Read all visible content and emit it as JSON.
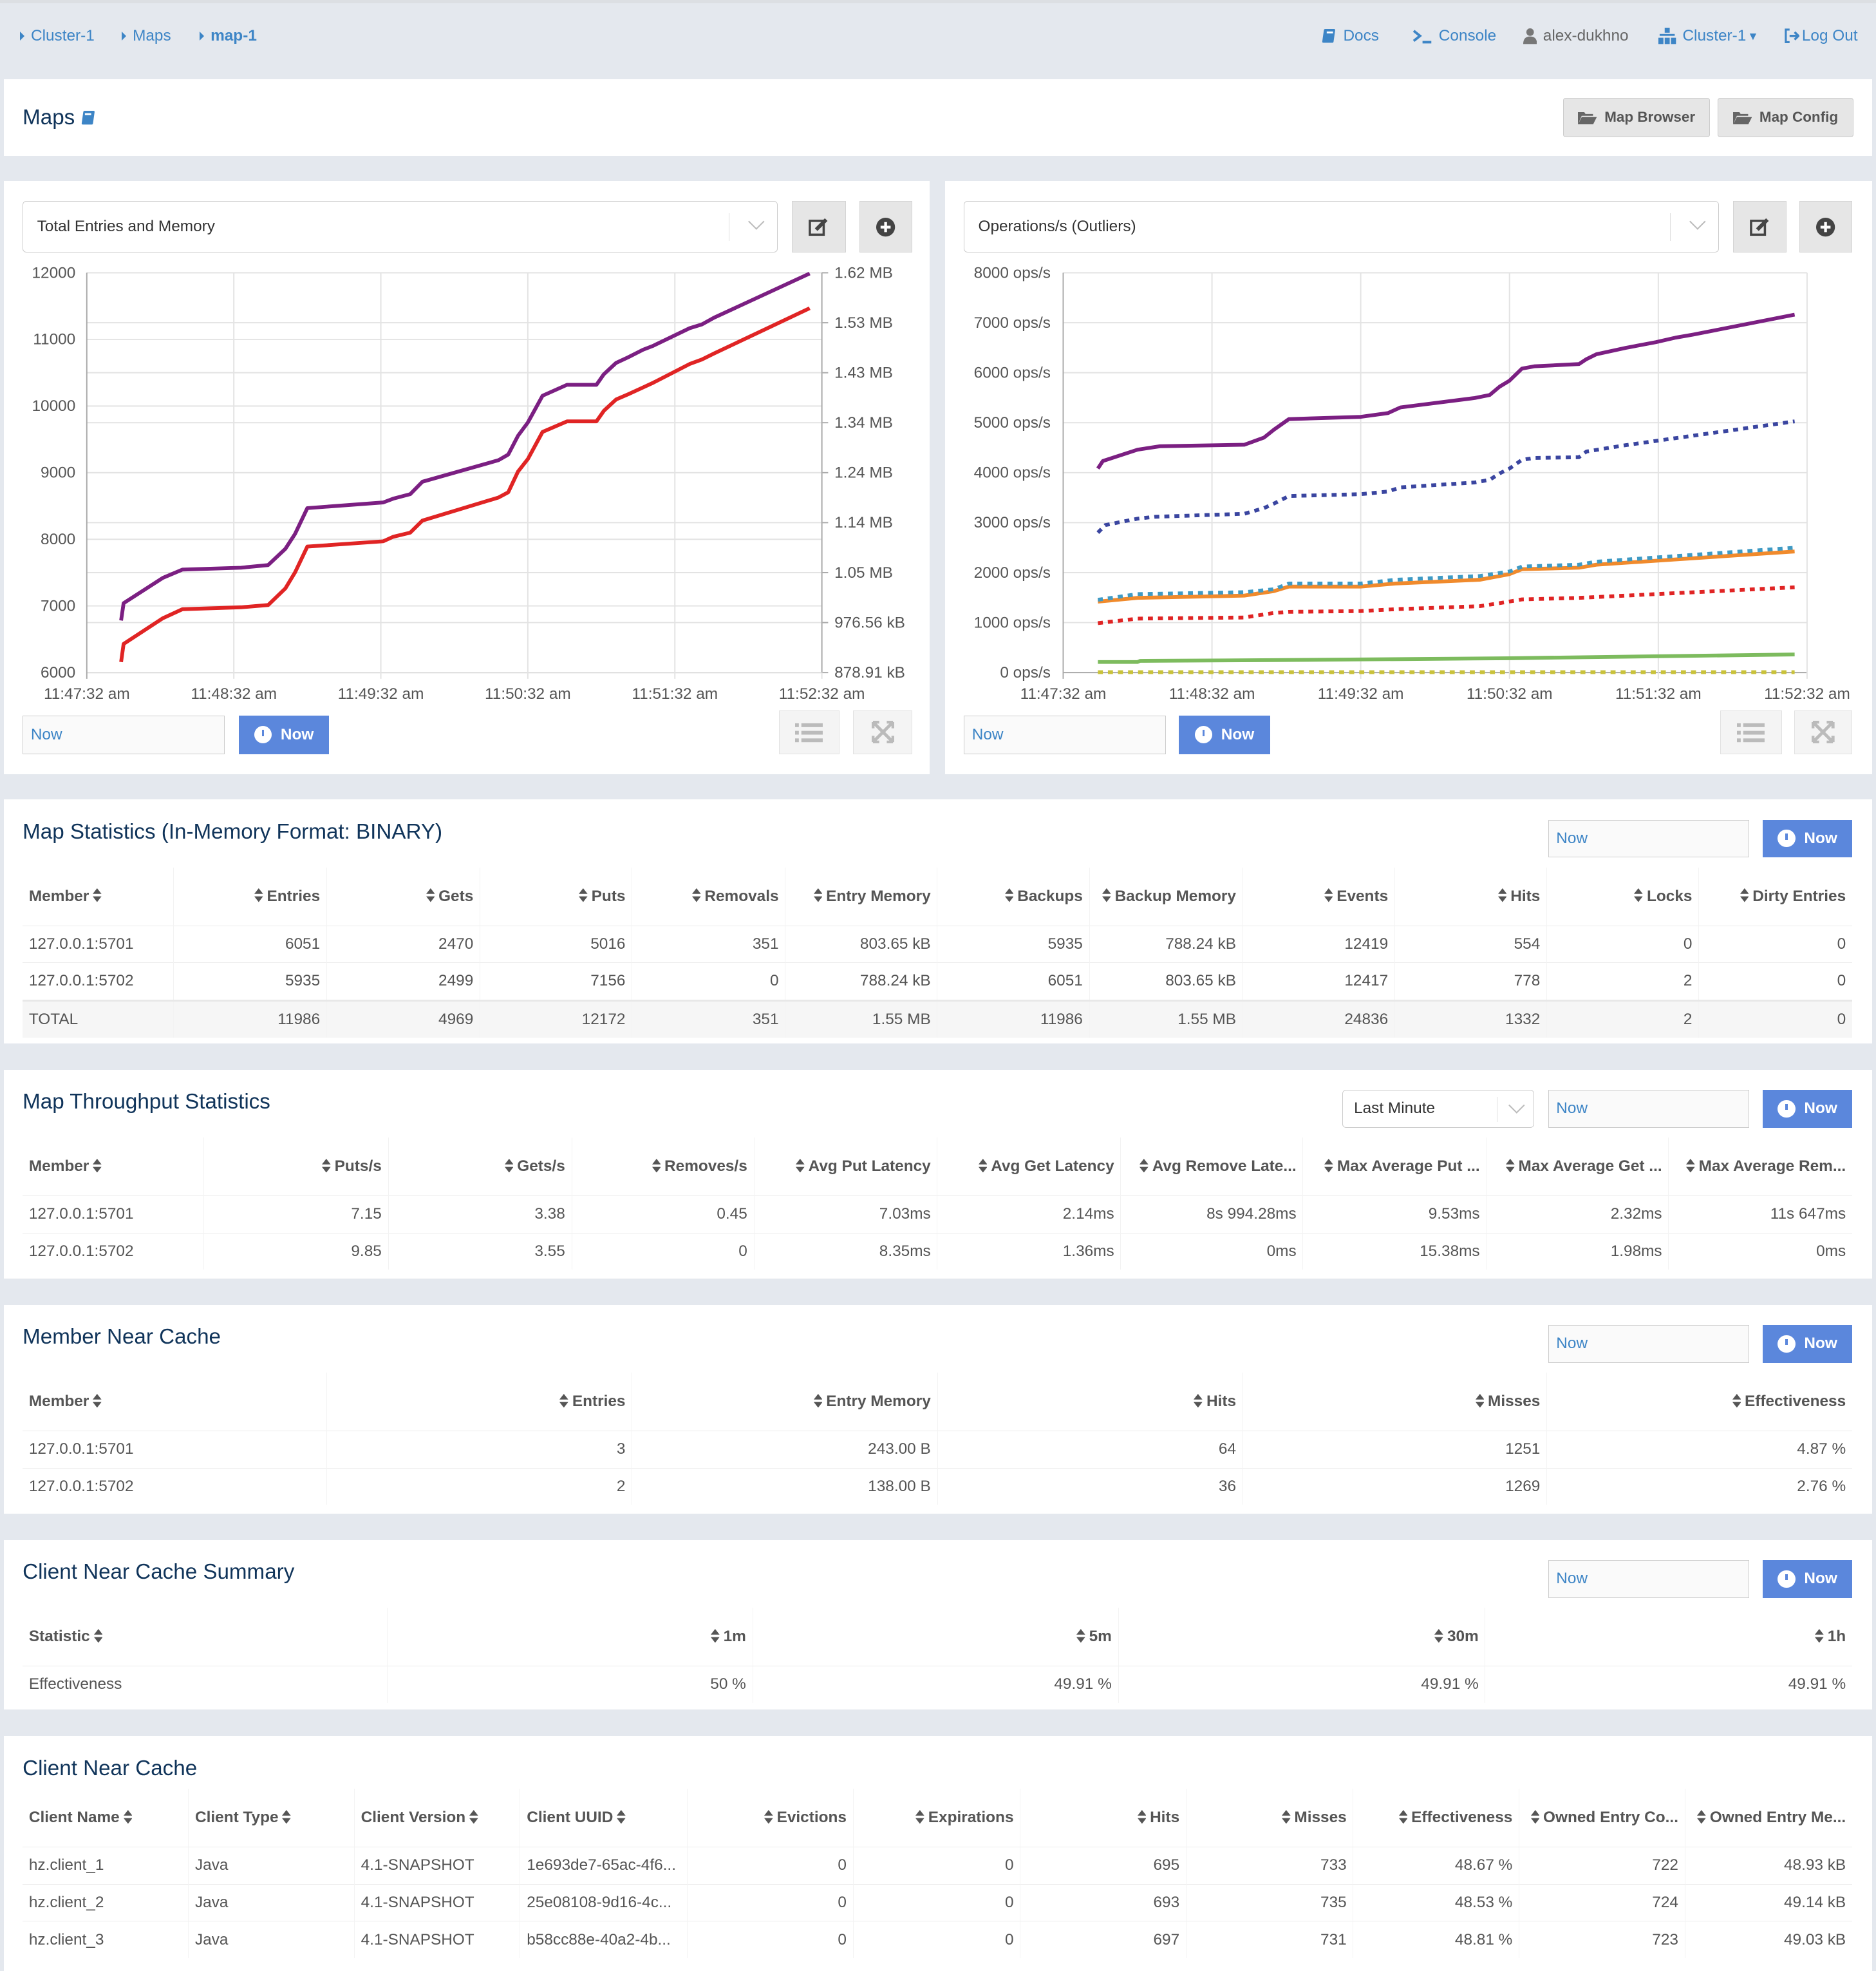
{
  "topbar": {
    "breadcrumb": [
      "Cluster-1",
      "Maps",
      "map-1"
    ],
    "docs": "Docs",
    "console": "Console",
    "user": "alex-dukhno",
    "cluster": "Cluster-1",
    "logout": "Log Out"
  },
  "header": {
    "title": "Maps",
    "map_browser": "Map Browser",
    "map_config": "Map Config"
  },
  "colors": {
    "link": "#3d85c6",
    "now_button": "#5b87dc",
    "title": "#10345a"
  },
  "charts": [
    {
      "selector_value": "Total Entries and Memory",
      "now_input": "Now",
      "now_button": "Now"
    },
    {
      "selector_value": "Operations/s (Outliers)",
      "now_input": "Now",
      "now_button": "Now"
    }
  ],
  "chart_data": [
    {
      "type": "line",
      "xlim": [
        "11:47:32",
        "11:52:32"
      ],
      "x_ticks": [
        "11:47:32 am",
        "11:48:32 am",
        "11:49:32 am",
        "11:50:32 am",
        "11:51:32 am",
        "11:52:32 am"
      ],
      "ylim": [
        6000,
        12000
      ],
      "y_ticks": [
        "12000",
        "11000",
        "10000",
        "9000",
        "8000",
        "7000",
        "6000"
      ],
      "y2_ticks": [
        "1.62 MB",
        "1.53 MB",
        "1.43 MB",
        "1.34 MB",
        "1.24 MB",
        "1.14 MB",
        "1.05 MB",
        "976.56 kB",
        "878.91 kB"
      ],
      "grid": true,
      "series": [
        {
          "color": "#7b1f82",
          "style": "solid",
          "points": [
            [
              "11:47:46",
              6781
            ],
            [
              "11:47:47",
              7041
            ],
            [
              "11:48:03",
              7421
            ],
            [
              "11:48:11",
              7545
            ],
            [
              "11:48:35",
              7573
            ],
            [
              "11:48:46",
              7613
            ],
            [
              "11:48:53",
              7857
            ],
            [
              "11:48:57",
              8083
            ],
            [
              "11:49:02",
              8468
            ],
            [
              "11:49:33",
              8553
            ],
            [
              "11:49:37",
              8609
            ],
            [
              "11:49:44",
              8677
            ],
            [
              "11:49:49",
              8864
            ],
            [
              "11:50:20",
              9187
            ],
            [
              "11:50:24",
              9271
            ],
            [
              "11:50:28",
              9555
            ],
            [
              "11:50:32",
              9753
            ],
            [
              "11:50:38",
              10154
            ],
            [
              "11:50:48",
              10319
            ],
            [
              "11:51:00",
              10319
            ],
            [
              "11:51:03",
              10477
            ],
            [
              "11:51:08",
              10647
            ],
            [
              "11:51:13",
              10732
            ],
            [
              "11:51:19",
              10845
            ],
            [
              "11:51:23",
              10902
            ],
            [
              "11:51:38",
              11168
            ],
            [
              "11:51:43",
              11224
            ],
            [
              "11:51:48",
              11326
            ],
            [
              "11:52:27",
              11988
            ]
          ]
        },
        {
          "color": "#e02424",
          "style": "solid",
          "points": [
            [
              "11:47:46",
              6158
            ],
            [
              "11:47:47",
              6430
            ],
            [
              "11:48:03",
              6815
            ],
            [
              "11:48:11",
              6951
            ],
            [
              "11:48:35",
              6979
            ],
            [
              "11:48:46",
              7013
            ],
            [
              "11:48:53",
              7262
            ],
            [
              "11:48:57",
              7506
            ],
            [
              "11:49:02",
              7890
            ],
            [
              "11:49:33",
              7970
            ],
            [
              "11:49:37",
              8038
            ],
            [
              "11:49:44",
              8100
            ],
            [
              "11:49:49",
              8281
            ],
            [
              "11:50:20",
              8626
            ],
            [
              "11:50:24",
              8706
            ],
            [
              "11:50:28",
              9017
            ],
            [
              "11:50:32",
              9204
            ],
            [
              "11:50:38",
              9611
            ],
            [
              "11:50:48",
              9770
            ],
            [
              "11:51:00",
              9770
            ],
            [
              "11:51:03",
              9928
            ],
            [
              "11:51:08",
              10098
            ],
            [
              "11:51:13",
              10177
            ],
            [
              "11:51:19",
              10279
            ],
            [
              "11:51:23",
              10347
            ],
            [
              "11:51:38",
              10630
            ],
            [
              "11:51:43",
              10698
            ],
            [
              "11:51:48",
              10789
            ],
            [
              "11:52:27",
              11468
            ]
          ]
        }
      ]
    },
    {
      "type": "line",
      "xlim": [
        "11:47:32",
        "11:52:32"
      ],
      "x_ticks": [
        "11:47:32 am",
        "11:48:32 am",
        "11:49:32 am",
        "11:50:32 am",
        "11:51:32 am",
        "11:52:32 am"
      ],
      "ylim": [
        0,
        8000
      ],
      "y_ticks": [
        "8000 ops/s",
        "7000 ops/s",
        "6000 ops/s",
        "5000 ops/s",
        "4000 ops/s",
        "3000 ops/s",
        "2000 ops/s",
        "1000 ops/s",
        "0 ops/s"
      ],
      "grid": true,
      "series": [
        {
          "color": "#7b1f82",
          "style": "solid",
          "points": [
            [
              "11:47:46",
              4083
            ],
            [
              "11:47:48",
              4234
            ],
            [
              "11:48:02",
              4460
            ],
            [
              "11:48:11",
              4528
            ],
            [
              "11:48:45",
              4558
            ],
            [
              "11:48:53",
              4702
            ],
            [
              "11:48:57",
              4860
            ],
            [
              "11:49:03",
              5072
            ],
            [
              "11:49:32",
              5117
            ],
            [
              "11:49:43",
              5192
            ],
            [
              "11:49:48",
              5306
            ],
            [
              "11:50:18",
              5494
            ],
            [
              "11:50:24",
              5555
            ],
            [
              "11:50:28",
              5721
            ],
            [
              "11:50:32",
              5841
            ],
            [
              "11:50:37",
              6083
            ],
            [
              "11:50:42",
              6128
            ],
            [
              "11:51:00",
              6174
            ],
            [
              "11:51:03",
              6272
            ],
            [
              "11:51:07",
              6370
            ],
            [
              "11:51:19",
              6498
            ],
            [
              "11:51:31",
              6611
            ],
            [
              "11:51:39",
              6702
            ],
            [
              "11:51:46",
              6762
            ],
            [
              "11:52:27",
              7162
            ]
          ]
        },
        {
          "color": "#3a45a0",
          "style": "dotted",
          "points": [
            [
              "11:47:46",
              2800
            ],
            [
              "11:47:49",
              2951
            ],
            [
              "11:48:02",
              3079
            ],
            [
              "11:48:09",
              3117
            ],
            [
              "11:48:45",
              3177
            ],
            [
              "11:48:53",
              3290
            ],
            [
              "11:48:57",
              3381
            ],
            [
              "11:49:03",
              3532
            ],
            [
              "11:49:32",
              3570
            ],
            [
              "11:49:43",
              3623
            ],
            [
              "11:49:48",
              3706
            ],
            [
              "11:50:18",
              3804
            ],
            [
              "11:50:24",
              3857
            ],
            [
              "11:50:28",
              3985
            ],
            [
              "11:50:32",
              4083
            ],
            [
              "11:50:37",
              4257
            ],
            [
              "11:50:42",
              4294
            ],
            [
              "11:51:00",
              4309
            ],
            [
              "11:51:03",
              4423
            ],
            [
              "11:51:19",
              4551
            ],
            [
              "11:52:27",
              5026
            ]
          ]
        },
        {
          "color": "#f08a2c",
          "style": "solid",
          "points": [
            [
              "11:47:46",
              1419
            ],
            [
              "11:48:02",
              1494
            ],
            [
              "11:48:45",
              1540
            ],
            [
              "11:48:57",
              1630
            ],
            [
              "11:49:03",
              1721
            ],
            [
              "11:49:32",
              1721
            ],
            [
              "11:49:46",
              1781
            ],
            [
              "11:50:20",
              1857
            ],
            [
              "11:50:32",
              1970
            ],
            [
              "11:50:37",
              2068
            ],
            [
              "11:51:00",
              2098
            ],
            [
              "11:51:07",
              2158
            ],
            [
              "11:52:27",
              2423
            ]
          ]
        },
        {
          "color": "#3f9ac4",
          "style": "dotted",
          "points": [
            [
              "11:47:46",
              1457
            ],
            [
              "11:48:02",
              1570
            ],
            [
              "11:48:45",
              1608
            ],
            [
              "11:48:57",
              1668
            ],
            [
              "11:49:03",
              1781
            ],
            [
              "11:49:32",
              1781
            ],
            [
              "11:49:46",
              1857
            ],
            [
              "11:50:20",
              1932
            ],
            [
              "11:50:32",
              2023
            ],
            [
              "11:50:37",
              2121
            ],
            [
              "11:51:00",
              2158
            ],
            [
              "11:51:07",
              2219
            ],
            [
              "11:52:27",
              2498
            ]
          ]
        },
        {
          "color": "#e02424",
          "style": "dotted",
          "points": [
            [
              "11:47:46",
              989
            ],
            [
              "11:48:02",
              1079
            ],
            [
              "11:48:45",
              1102
            ],
            [
              "11:48:57",
              1192
            ],
            [
              "11:49:03",
              1215
            ],
            [
              "11:49:32",
              1230
            ],
            [
              "11:49:46",
              1268
            ],
            [
              "11:50:20",
              1328
            ],
            [
              "11:50:28",
              1389
            ],
            [
              "11:50:37",
              1464
            ],
            [
              "11:51:00",
              1494
            ],
            [
              "11:52:27",
              1706
            ]
          ]
        },
        {
          "color": "#7dbb5e",
          "style": "solid",
          "points": [
            [
              "11:47:46",
              211
            ],
            [
              "11:48:02",
              211
            ],
            [
              "11:48:03",
              234
            ],
            [
              "11:48:57",
              249
            ],
            [
              "11:50:32",
              287
            ],
            [
              "11:52:27",
              362
            ]
          ]
        },
        {
          "color": "#c9c23a",
          "style": "dotted",
          "points": [
            [
              "11:47:46",
              8
            ],
            [
              "11:52:27",
              8
            ]
          ]
        }
      ]
    }
  ],
  "map_stats": {
    "title": "Map Statistics (In-Memory Format: BINARY)",
    "now_input": "Now",
    "now_button": "Now",
    "columns": [
      "Member",
      "Entries",
      "Gets",
      "Puts",
      "Removals",
      "Entry Memory",
      "Backups",
      "Backup Memory",
      "Events",
      "Hits",
      "Locks",
      "Dirty Entries"
    ],
    "rows": [
      [
        "127.0.0.1:5701",
        "6051",
        "2470",
        "5016",
        "351",
        "803.65 kB",
        "5935",
        "788.24 kB",
        "12419",
        "554",
        "0",
        "0"
      ],
      [
        "127.0.0.1:5702",
        "5935",
        "2499",
        "7156",
        "0",
        "788.24 kB",
        "6051",
        "803.65 kB",
        "12417",
        "778",
        "2",
        "0"
      ]
    ],
    "total": [
      "TOTAL",
      "11986",
      "4969",
      "12172",
      "351",
      "1.55 MB",
      "11986",
      "1.55 MB",
      "24836",
      "1332",
      "2",
      "0"
    ]
  },
  "throughput": {
    "title": "Map Throughput Statistics",
    "range": "Last Minute",
    "now_input": "Now",
    "now_button": "Now",
    "columns": [
      "Member",
      "Puts/s",
      "Gets/s",
      "Removes/s",
      "Avg Put Latency",
      "Avg Get Latency",
      "Avg Remove Late...",
      "Max Average Put ...",
      "Max Average Get ...",
      "Max Average Rem..."
    ],
    "rows": [
      [
        "127.0.0.1:5701",
        "7.15",
        "3.38",
        "0.45",
        "7.03ms",
        "2.14ms",
        "8s 994.28ms",
        "9.53ms",
        "2.32ms",
        "11s 647ms"
      ],
      [
        "127.0.0.1:5702",
        "9.85",
        "3.55",
        "0",
        "8.35ms",
        "1.36ms",
        "0ms",
        "15.38ms",
        "1.98ms",
        "0ms"
      ]
    ]
  },
  "member_near_cache": {
    "title": "Member Near Cache",
    "now_input": "Now",
    "now_button": "Now",
    "columns": [
      "Member",
      "Entries",
      "Entry Memory",
      "Hits",
      "Misses",
      "Effectiveness"
    ],
    "rows": [
      [
        "127.0.0.1:5701",
        "3",
        "243.00 B",
        "64",
        "1251",
        "4.87 %"
      ],
      [
        "127.0.0.1:5702",
        "2",
        "138.00 B",
        "36",
        "1269",
        "2.76 %"
      ]
    ]
  },
  "client_summary": {
    "title": "Client Near Cache Summary",
    "now_input": "Now",
    "now_button": "Now",
    "columns": [
      "Statistic",
      "1m",
      "5m",
      "30m",
      "1h"
    ],
    "rows": [
      [
        "Effectiveness",
        "50 %",
        "49.91 %",
        "49.91 %",
        "49.91 %"
      ]
    ]
  },
  "client_near_cache": {
    "title": "Client Near Cache",
    "columns": [
      "Client Name",
      "Client Type",
      "Client Version",
      "Client UUID",
      "Evictions",
      "Expirations",
      "Hits",
      "Misses",
      "Effectiveness",
      "Owned Entry Co...",
      "Owned Entry Me..."
    ],
    "rows": [
      [
        "hz.client_1",
        "Java",
        "4.1-SNAPSHOT",
        "1e693de7-65ac-4f6...",
        "0",
        "0",
        "695",
        "733",
        "48.67 %",
        "722",
        "48.93 kB"
      ],
      [
        "hz.client_2",
        "Java",
        "4.1-SNAPSHOT",
        "25e08108-9d16-4c...",
        "0",
        "0",
        "693",
        "735",
        "48.53 %",
        "724",
        "49.14 kB"
      ],
      [
        "hz.client_3",
        "Java",
        "4.1-SNAPSHOT",
        "b58cc88e-40a2-4b...",
        "0",
        "0",
        "697",
        "731",
        "48.81 %",
        "723",
        "49.03 kB"
      ]
    ]
  }
}
